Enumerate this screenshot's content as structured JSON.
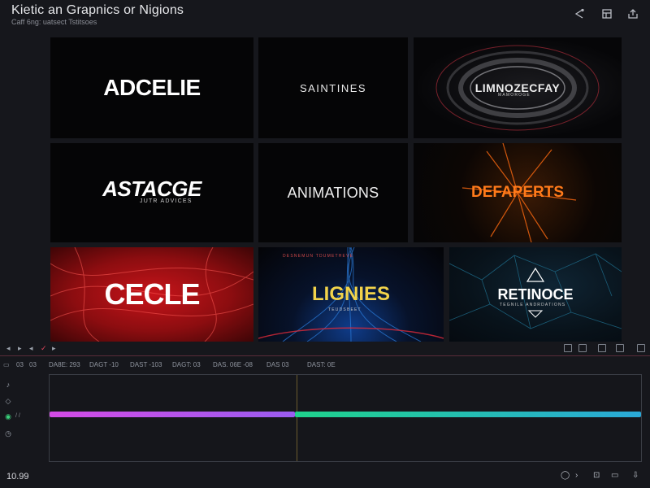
{
  "header": {
    "title": "Kietic an Grapnics or Nigions",
    "subtitle": "Caff 6ng:  uatsect Tstitsoes",
    "icons": [
      "share-icon",
      "layout-icon",
      "export-icon"
    ]
  },
  "tiles": [
    {
      "text": "ADCELIE",
      "sub": ""
    },
    {
      "text": "SAINTINES",
      "sub": ""
    },
    {
      "text": "LIMNOZECFAY",
      "sub": "MAMOROGE"
    },
    {
      "text": "ASTACGE",
      "sub": "JUTR ADVICES"
    },
    {
      "text": "ANIMATIONS",
      "sub": ""
    },
    {
      "text": "DEFAPERTS",
      "sub": ""
    },
    {
      "text": "CECLE",
      "sub": ""
    },
    {
      "text": "LIGNIES",
      "sub": "DESNEMUN TDUMETHEVE",
      "sub2": "TEUDSBEET"
    },
    {
      "text": "RETINOCE",
      "sub": "TEGNILE ANDRDATIONS"
    }
  ],
  "timeline": {
    "ruler_labels": [
      "03",
      "03",
      "DA8E: 293",
      "DAGT -10",
      "DAST -103",
      "DAGT: 03",
      "DAS. 06E -08",
      "DAS 03",
      "DAST: 0E"
    ],
    "track_labels": [
      "",
      "",
      "/ /",
      ""
    ],
    "time_display": "10.99",
    "colors": {
      "clip_a": "#d44be6",
      "clip_b": "#1fd38c",
      "accent": "#e0455c"
    }
  }
}
